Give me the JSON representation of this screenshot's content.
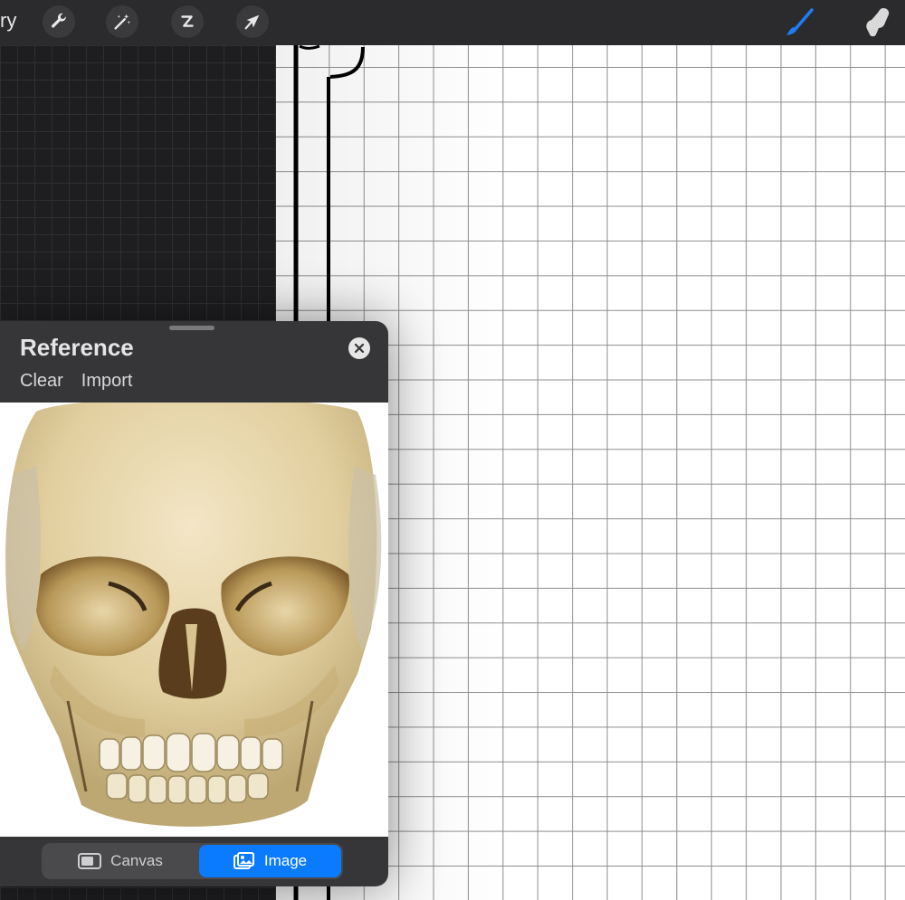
{
  "toolbar": {
    "gallery_label": "ry",
    "icons": [
      "wrench-icon",
      "magic-wand-icon",
      "selection-icon",
      "transform-arrow-icon",
      "brush-icon",
      "smudge-icon"
    ],
    "accent_color": "#1e7cf5"
  },
  "reference": {
    "title": "Reference",
    "actions": [
      "Clear",
      "Import"
    ],
    "tabs": [
      {
        "label": "Canvas",
        "icon": "canvas-icon",
        "selected": false
      },
      {
        "label": "Image",
        "icon": "image-icon",
        "selected": true
      }
    ]
  }
}
